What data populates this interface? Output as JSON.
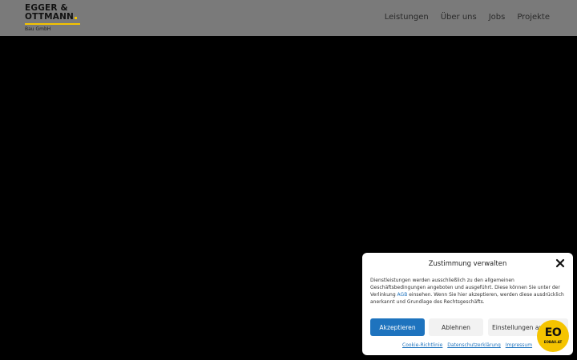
{
  "header": {
    "logo": {
      "line1": "EGGER &",
      "line2": "OTTMANN",
      "subtitle": "Bau GmbH"
    },
    "nav": [
      {
        "label": "Leistungen"
      },
      {
        "label": "Über uns"
      },
      {
        "label": "Jobs"
      },
      {
        "label": "Projekte"
      }
    ]
  },
  "consent": {
    "title": "Zustimmung verwalten",
    "text_before_link": "Dienstleistungen werden ausschließlich zu den allgemeinen Geschäftsbedingungen angeboten und ausgeführt. Diese können Sie unter der Verlinkung ",
    "link_text": "AGB",
    "text_after_link": " einsehen. Wenn Sie hier akzeptieren, werden diese ausdrücklich anerkannt und Grundlage des Rechtsgeschäfts.",
    "buttons": {
      "accept": "Akzeptieren",
      "decline": "Ablehnen",
      "settings": "Einstellungen an"
    },
    "links": {
      "cookie_policy": "Cookie-Richtlinie",
      "privacy": "Datenschutzerklärung",
      "imprint": "Impressum"
    }
  },
  "badge": {
    "main": "EO",
    "sub": "EOBAU.AT"
  },
  "colors": {
    "header_bg": "#7a7a7a",
    "accent_yellow": "#f5c400",
    "button_blue": "#1e73be"
  }
}
